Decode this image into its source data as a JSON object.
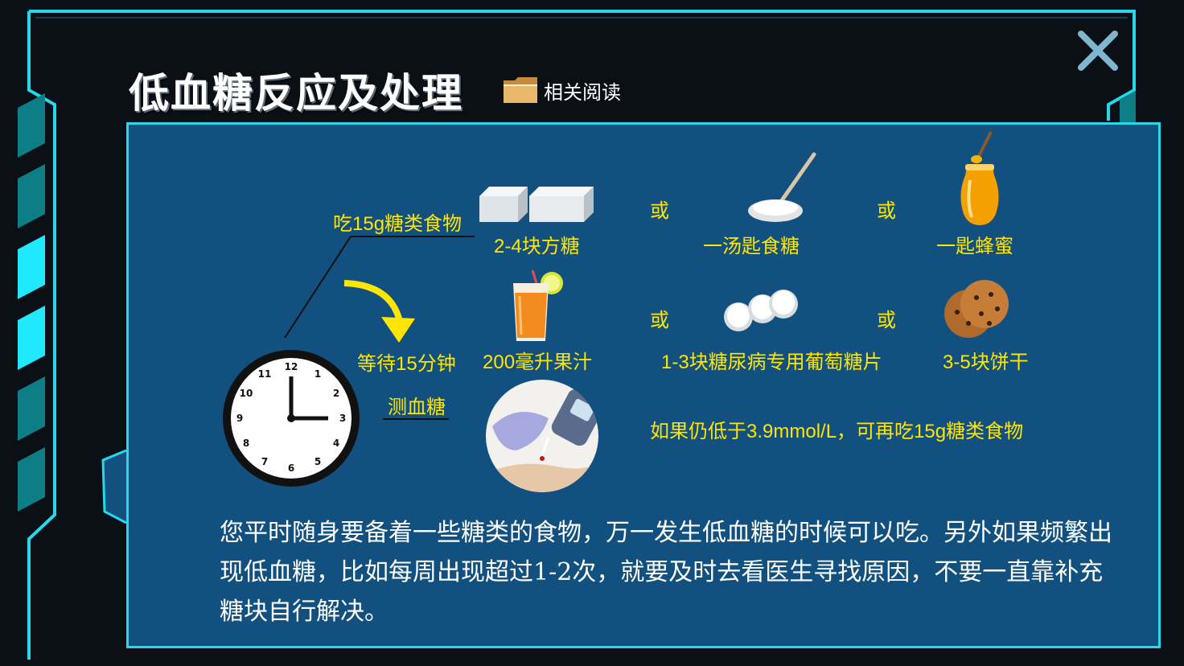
{
  "header": {
    "title": "低血糖反应及处理",
    "related_label": "相关阅读",
    "folder_icon": "folder-icon",
    "close_icon": "close-icon"
  },
  "diagram": {
    "step1_label": "吃15g糖类食物",
    "step2_label": "等待15分钟",
    "step3_label": "测血糖",
    "or_label": "或",
    "food_options": [
      {
        "label": "2-4块方糖",
        "icon": "sugar-cubes-icon"
      },
      {
        "label": "一汤匙食糖",
        "icon": "spoon-sugar-icon"
      },
      {
        "label": "一匙蜂蜜",
        "icon": "honey-jar-icon"
      },
      {
        "label": "200毫升果汁",
        "icon": "juice-glass-icon"
      },
      {
        "label": "1-3块糖尿病专用葡萄糖片",
        "icon": "glucose-tablets-icon"
      },
      {
        "label": "3-5块饼干",
        "icon": "cookies-icon"
      }
    ],
    "recheck_note": "如果仍低于3.9mmol/L，可再吃15g糖类食物"
  },
  "body_text": "您平时随身要备着一些糖类的食物，万一发生低血糖的时候可以吃。另外如果频繁出现低血糖，比如每周出现超过1-2次，就要及时去看医生寻找原因，不要一直靠补充糖块自行解决。",
  "colors": {
    "accent": "#27d8ea",
    "panel": "#125080",
    "highlight_text": "#ffe600",
    "background": "#0b1016"
  }
}
